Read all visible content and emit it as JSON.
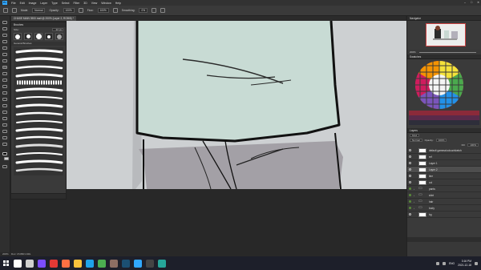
{
  "app": {
    "logo": "Ps",
    "menus": [
      "File",
      "Edit",
      "Image",
      "Layer",
      "Type",
      "Select",
      "Filter",
      "3D",
      "View",
      "Window",
      "Help"
    ],
    "window_controls": [
      "–",
      "□",
      "✕"
    ]
  },
  "options": {
    "mode_label": "Mode:",
    "mode_value": "Normal",
    "opacity_label": "Opacity:",
    "opacity_value": "100%",
    "flow_label": "Flow:",
    "flow_value": "100%",
    "smoothing_label": "Smoothing:",
    "smoothing_value": "0%"
  },
  "document": {
    "tab_title": "CHASE MAIN 3900 mail @ 200% (Layer 2, RGB/8) *"
  },
  "brushes_panel": {
    "title": "Brushes",
    "size_label": "Size:",
    "size_value": "22 px",
    "group_label": "General Brushes"
  },
  "navigator": {
    "title": "Navigator",
    "zoom_value": "200%"
  },
  "swatches": {
    "title": "Swatches"
  },
  "layers": {
    "title": "Layers",
    "kind_label": "Kind",
    "blend_mode": "Normal",
    "opacity_label": "Opacity:",
    "opacity_value": "100%",
    "fill_label": "Fill:",
    "fill_value": "100%",
    "rows": [
      {
        "name": "default gamma/colour/sketch",
        "type": "layer",
        "visible": true,
        "selected": false,
        "green": false
      },
      {
        "name": "ref",
        "type": "layer",
        "visible": true,
        "selected": false,
        "green": false
      },
      {
        "name": "Layer 1",
        "type": "layer",
        "visible": true,
        "selected": false,
        "green": false
      },
      {
        "name": "Layer 2",
        "type": "layer",
        "visible": true,
        "selected": true,
        "green": false
      },
      {
        "name": "line",
        "type": "layer",
        "visible": true,
        "selected": false,
        "green": false
      },
      {
        "name": "col",
        "type": "layer",
        "visible": true,
        "selected": false,
        "green": false
      },
      {
        "name": "pants",
        "type": "folder",
        "visible": true,
        "selected": false,
        "green": true
      },
      {
        "name": "shirt",
        "type": "folder",
        "visible": true,
        "selected": false,
        "green": true
      },
      {
        "name": "hair",
        "type": "folder",
        "visible": true,
        "selected": false,
        "green": true
      },
      {
        "name": "body",
        "type": "folder",
        "visible": true,
        "selected": false,
        "green": true
      },
      {
        "name": "bg",
        "type": "layer",
        "visible": true,
        "selected": false,
        "green": false
      }
    ]
  },
  "status": {
    "zoom": "200%",
    "doc": "Doc: 15.8M/1.04G"
  },
  "taskbar": {
    "time": "3:16 PM",
    "date": "2021-12-18",
    "lang": "ENG",
    "icons": [
      {
        "name": "search-icon",
        "color": "#ffffff"
      },
      {
        "name": "task-view-icon",
        "color": "#d0d0d0"
      },
      {
        "name": "app-icon-1",
        "color": "#7c4dff"
      },
      {
        "name": "app-icon-2",
        "color": "#e53935"
      },
      {
        "name": "app-icon-3",
        "color": "#ff7043"
      },
      {
        "name": "file-explorer-icon",
        "color": "#f9c23c"
      },
      {
        "name": "edge-icon",
        "color": "#1fa3e8"
      },
      {
        "name": "chrome-icon",
        "color": "#4caf50"
      },
      {
        "name": "app-icon-4",
        "color": "#8d6e63"
      },
      {
        "name": "steam-icon",
        "color": "#1b4f72"
      },
      {
        "name": "photoshop-icon",
        "color": "#31a8ff"
      },
      {
        "name": "app-icon-5",
        "color": "#444444"
      },
      {
        "name": "app-icon-6",
        "color": "#26a69a"
      }
    ]
  }
}
